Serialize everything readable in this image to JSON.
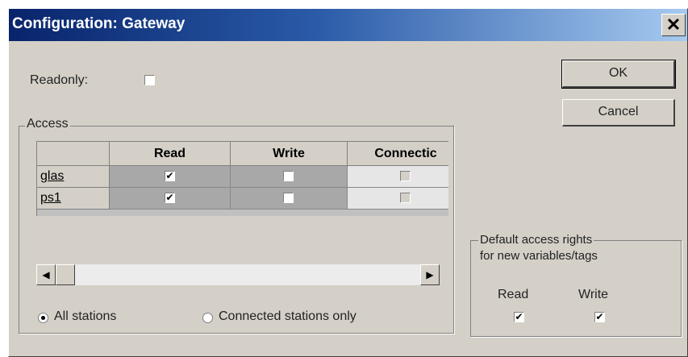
{
  "window": {
    "title": "Configuration: Gateway",
    "close_glyph": "✕"
  },
  "readonly": {
    "label": "Readonly:",
    "checked": false
  },
  "buttons": {
    "ok": "OK",
    "cancel": "Cancel"
  },
  "access": {
    "title": "Access",
    "columns": [
      "Read",
      "Write",
      "Connectic"
    ],
    "rows": [
      {
        "name": "glas",
        "read": true,
        "write": false,
        "connect": false
      },
      {
        "name": "ps1",
        "read": true,
        "write": false,
        "connect": false
      }
    ],
    "radios": [
      {
        "label": "All stations",
        "selected": true
      },
      {
        "label": "Connected stations only",
        "selected": false
      }
    ]
  },
  "defaults": {
    "title_line1": "Default access rights",
    "title_line2": "for new variables/tags",
    "read_label": "Read",
    "write_label": "Write",
    "read_checked": true,
    "write_checked": true
  },
  "icons": {
    "check": "✔",
    "scroll_left": "◀",
    "scroll_right": "▶"
  }
}
